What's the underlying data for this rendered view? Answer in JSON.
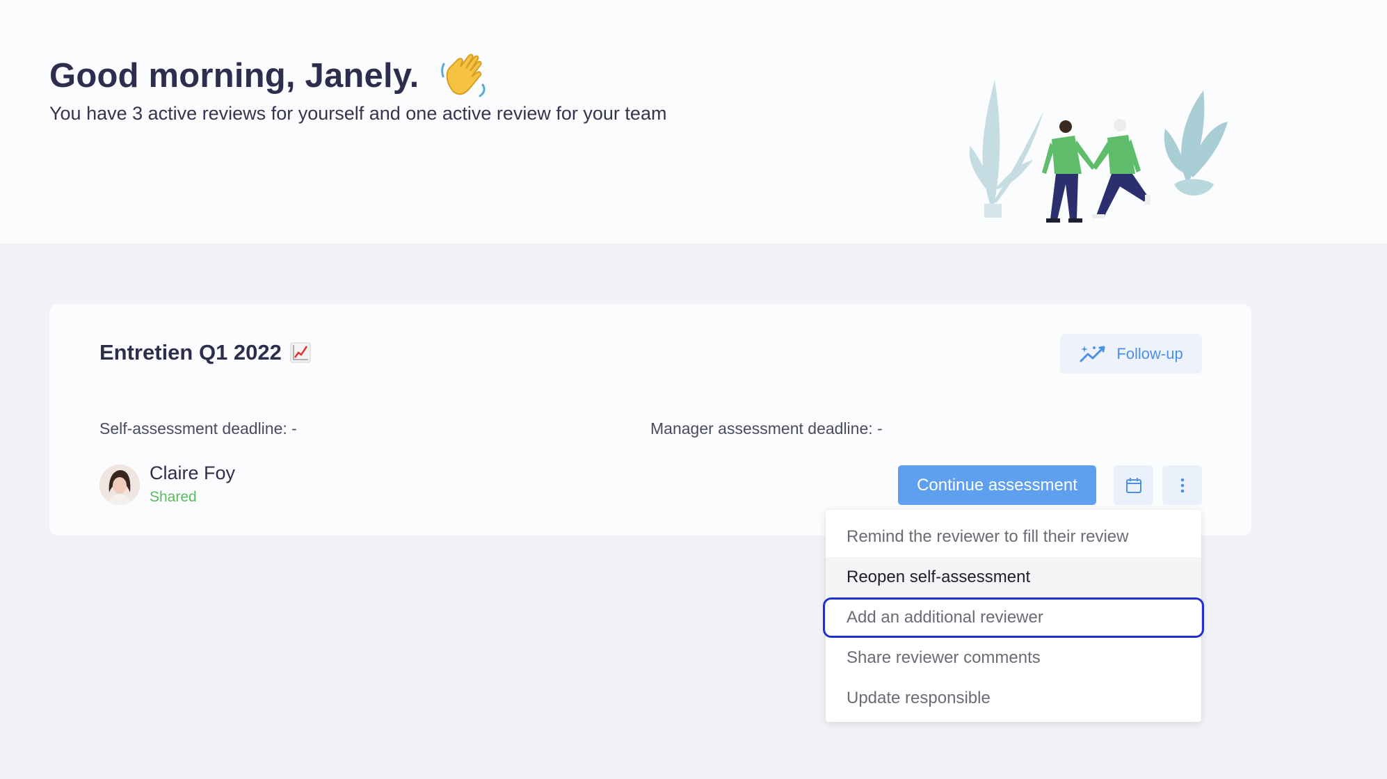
{
  "hero": {
    "greeting": "Good morning, Janely.",
    "subtitle": "You have 3 active reviews for yourself and one active review for your team"
  },
  "card": {
    "title": "Entretien Q1 2022",
    "followup_label": "Follow-up",
    "self_deadline": "Self-assessment deadline: -",
    "manager_deadline": "Manager assessment deadline: -",
    "person": {
      "name": "Claire Foy",
      "status": "Shared"
    },
    "continue_label": "Continue assessment"
  },
  "menu": {
    "items": [
      {
        "label": "Remind the reviewer to fill their review"
      },
      {
        "label": "Reopen self-assessment"
      },
      {
        "label": "Add an additional reviewer"
      },
      {
        "label": "Share reviewer comments"
      },
      {
        "label": "Update responsible"
      }
    ]
  },
  "colors": {
    "accent": "#5ea0ef",
    "status_green": "#5cba5c",
    "focus_ring": "#1f2fd6"
  },
  "icons": [
    "waving-hand-icon",
    "chart-increasing-icon",
    "sparkle-chart-icon",
    "calendar-icon",
    "kebab-menu-icon"
  ]
}
